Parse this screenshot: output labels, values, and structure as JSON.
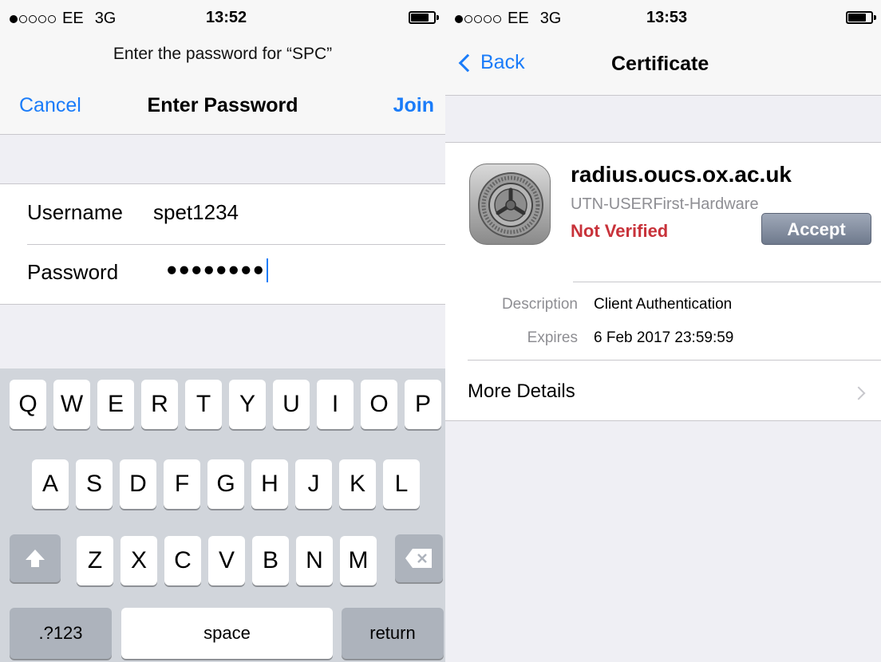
{
  "left": {
    "status": {
      "carrier": "EE",
      "network": "3G",
      "time": "13:52"
    },
    "prompt": "Enter the password for “SPC”",
    "nav": {
      "cancel": "Cancel",
      "title": "Enter Password",
      "join": "Join"
    },
    "form": {
      "username_label": "Username",
      "username_value": "spet1234",
      "password_label": "Password",
      "password_value": "●●●●●●●●"
    },
    "keyboard": {
      "row1": [
        "Q",
        "W",
        "E",
        "R",
        "T",
        "Y",
        "U",
        "I",
        "O",
        "P"
      ],
      "row2": [
        "A",
        "S",
        "D",
        "F",
        "G",
        "H",
        "J",
        "K",
        "L"
      ],
      "row3": [
        "Z",
        "X",
        "C",
        "V",
        "B",
        "N",
        "M"
      ],
      "numbers_key": ".?123",
      "space_key": "space",
      "return_key": "return"
    }
  },
  "right": {
    "status": {
      "carrier": "EE",
      "network": "3G",
      "time": "13:53"
    },
    "nav": {
      "back": "Back",
      "title": "Certificate"
    },
    "cert": {
      "name": "radius.oucs.ox.ac.uk",
      "issuer": "UTN-USERFirst-Hardware",
      "status": "Not Verified",
      "accept": "Accept",
      "description_label": "Description",
      "description_value": "Client Authentication",
      "expires_label": "Expires",
      "expires_value": "6 Feb 2017 23:59:59",
      "more_details": "More Details"
    }
  },
  "colors": {
    "ios_blue": "#1a7cf9",
    "not_verified_red": "#c8323a",
    "keyboard_bg": "#d1d5db"
  }
}
